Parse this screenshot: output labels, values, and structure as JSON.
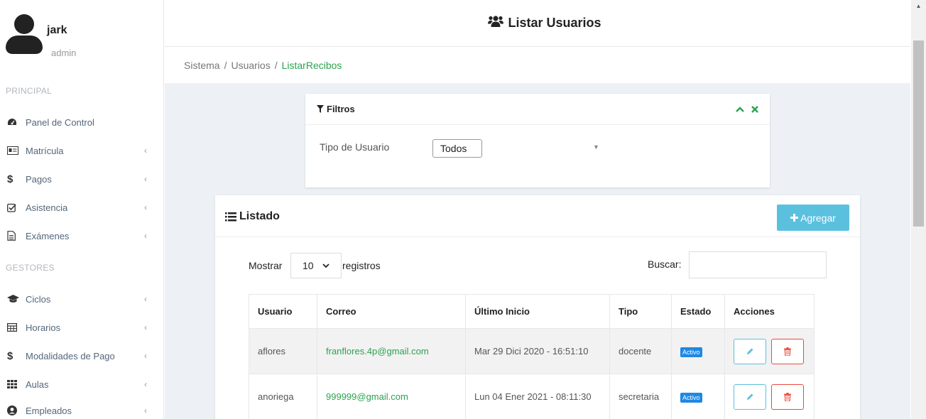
{
  "user": {
    "name": "jark",
    "role": "admin"
  },
  "sidebar": {
    "section_principal": "PRINCIPAL",
    "section_gestores": "GESTORES",
    "items": [
      {
        "label": "Panel de Control",
        "icon": "dashboard-icon",
        "has_chevron": false
      },
      {
        "label": "Matrícula",
        "icon": "id-card-icon",
        "has_chevron": true
      },
      {
        "label": "Pagos",
        "icon": "dollar-icon",
        "has_chevron": true
      },
      {
        "label": "Asistencia",
        "icon": "check-square-icon",
        "has_chevron": true
      },
      {
        "label": "Exámenes",
        "icon": "file-text-icon",
        "has_chevron": true
      },
      {
        "label": "Ciclos",
        "icon": "graduation-cap-icon",
        "has_chevron": true
      },
      {
        "label": "Horarios",
        "icon": "table-icon",
        "has_chevron": true
      },
      {
        "label": "Modalidades de Pago",
        "icon": "dollar-icon",
        "has_chevron": true
      },
      {
        "label": "Aulas",
        "icon": "grid-icon",
        "has_chevron": true
      },
      {
        "label": "Empleados",
        "icon": "user-circle-icon",
        "has_chevron": true
      }
    ],
    "chevron": "‹"
  },
  "header": {
    "title": "Listar Usuarios",
    "icon": "users-icon"
  },
  "breadcrumb": {
    "items": [
      "Sistema",
      "Usuarios",
      "ListarRecibos"
    ],
    "separator": "/"
  },
  "filters": {
    "title": "Filtros",
    "tipo_label": "Tipo de Usuario",
    "tipo_value": "Todos"
  },
  "listado": {
    "title": "Listado",
    "add_label": "Agregar",
    "mostrar_label": "Mostrar",
    "page_length": "10",
    "registros_label": "registros",
    "buscar_label": "Buscar:",
    "columns": [
      "Usuario",
      "Correo",
      "Último Inicio",
      "Tipo",
      "Estado",
      "Acciones"
    ],
    "rows": [
      {
        "usuario": "aflores",
        "correo": "franflores.4p@gmail.com",
        "ultimo": "Mar 29 Dici 2020 - 16:51:10",
        "tipo": "docente",
        "estado": "Activo"
      },
      {
        "usuario": "anoriega",
        "correo": "999999@gmail.com",
        "ultimo": "Lun 04 Ener 2021 - 08:11:30",
        "tipo": "secretaria",
        "estado": "Activo"
      }
    ]
  },
  "colors": {
    "accent_green": "#2ca24f",
    "info": "#5bc0de",
    "danger": "#e74c3c",
    "badge": "#1e88e5"
  }
}
